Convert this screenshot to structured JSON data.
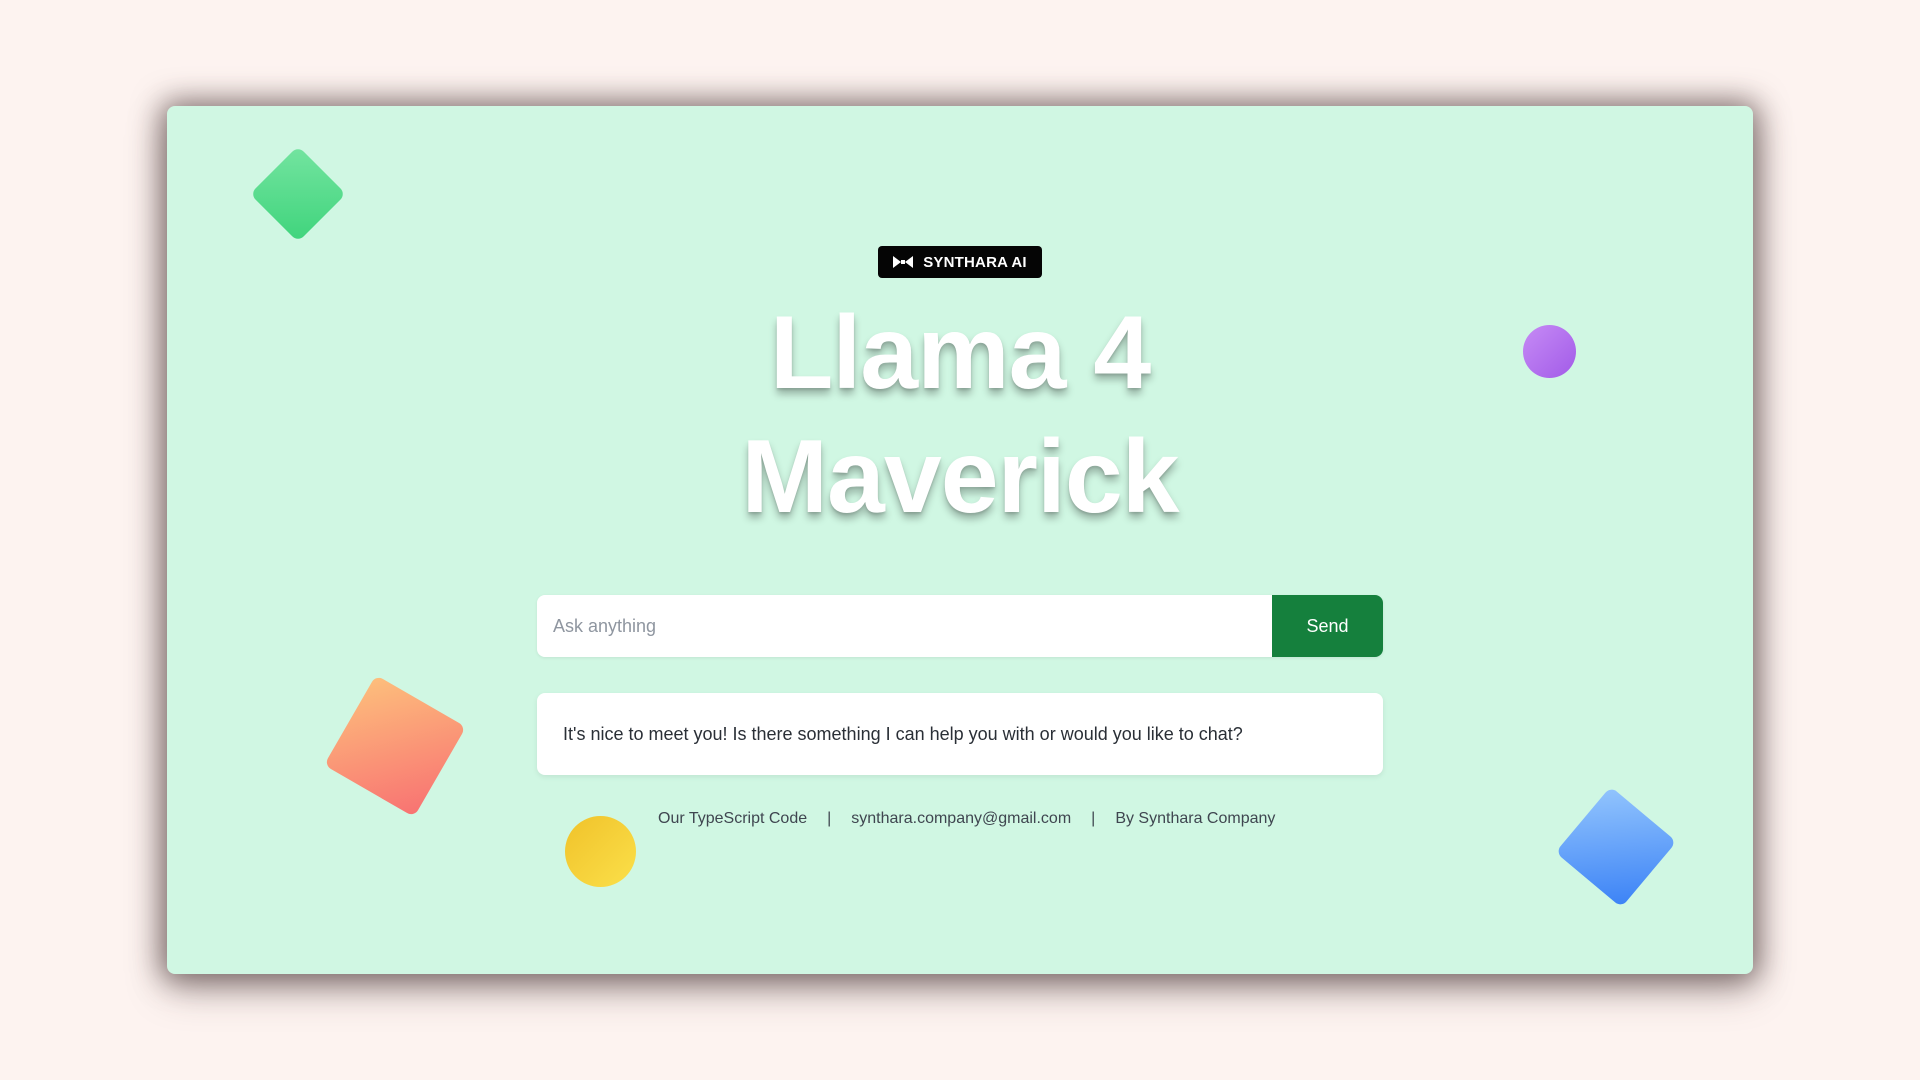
{
  "badge": {
    "icon": "bowtie-logo-icon",
    "label": "SYNTHARA AI"
  },
  "hero": {
    "title_line1": "Llama 4",
    "title_line2": "Maverick"
  },
  "search": {
    "placeholder": "Ask anything",
    "value": "",
    "send_label": "Send"
  },
  "response": {
    "text": "It's nice to meet you! Is there something I can help you with or would you like to chat?"
  },
  "footer": {
    "code_link": "Our TypeScript Code",
    "separator": "|",
    "email": "synthara.company@gmail.com",
    "credit": "By Synthara Company"
  },
  "colors": {
    "page_background": "#fdf3f0",
    "window_background": "#d0f7e3",
    "accent_button": "#15803d",
    "badge_background": "#050505"
  }
}
